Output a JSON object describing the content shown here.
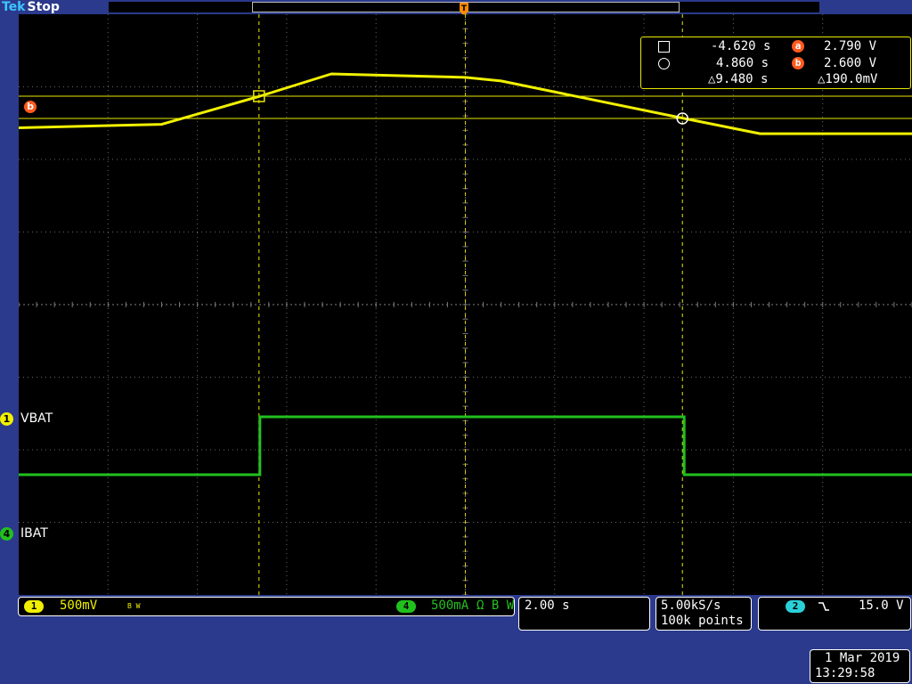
{
  "app": {
    "brand": "Tek",
    "run_state": "Stop"
  },
  "trigger_position_marker": "T",
  "ref_line_b_marker": "b",
  "cursor_readout": {
    "cursor1_time": "-4.620 s",
    "cursor2_time": "4.860 s",
    "delta_time": "△9.480 s",
    "cursor_a_label": "a",
    "cursor_a_value": "2.790 V",
    "cursor_b_label": "b",
    "cursor_b_value": "2.600 V",
    "delta_value": "△190.0mV"
  },
  "channels": [
    {
      "number": "1",
      "label": "VBAT",
      "scale": "500mV",
      "color": "#f0f000",
      "bw_flag": "B W"
    },
    {
      "number": "4",
      "label": "IBAT",
      "scale": "500mA",
      "color": "#22c01e",
      "coupling_flag": "Ω B W"
    }
  ],
  "timebase": {
    "scale": "2.00 s"
  },
  "acquisition": {
    "sample_rate": "5.00kS/s",
    "record_length": "100k points"
  },
  "trigger": {
    "channel": "2",
    "slope_icon": "falling-edge",
    "level": "15.0 V",
    "color": "#2ad0d8"
  },
  "datetime": {
    "date": "1 Mar 2019",
    "time": "13:29:58"
  },
  "colors": {
    "background": "#2b3a8c",
    "ch1": "#f0f000",
    "ch4": "#22c01e",
    "cursor": "#e8e800",
    "accent_orange": "#ff5a1f"
  },
  "chart_data": {
    "type": "line",
    "x_unit": "s",
    "x_range": [
      -10,
      10
    ],
    "series": [
      {
        "name": "VBAT",
        "channel": "1",
        "volts_per_div": 0.5,
        "x": [
          -10,
          -6.8,
          -4.6,
          -3.0,
          0,
          0.8,
          4.9,
          6.6,
          10
        ],
        "y": [
          2.52,
          2.55,
          2.79,
          2.98,
          2.95,
          2.92,
          2.6,
          2.47,
          2.47
        ]
      },
      {
        "name": "IBAT",
        "channel": "4",
        "amps_per_div": 0.5,
        "x": [
          -10,
          -4.6,
          -4.6,
          4.9,
          4.9,
          10
        ],
        "y": [
          0.0,
          0.0,
          0.5,
          0.5,
          0.0,
          0.0
        ]
      }
    ],
    "cursors": {
      "x1": -4.62,
      "x2": 4.86,
      "ya_volts": 2.79,
      "yb_volts": 2.6
    }
  }
}
